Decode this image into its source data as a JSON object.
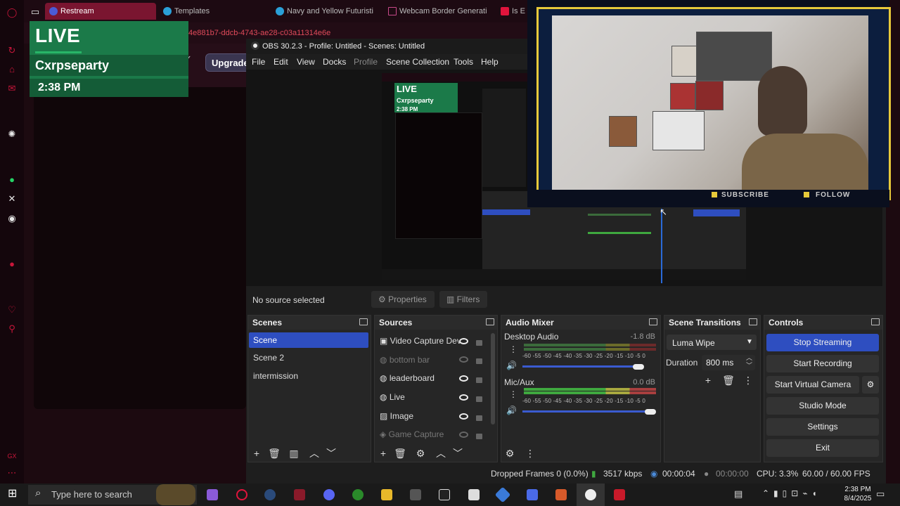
{
  "browser": {
    "tabs": [
      {
        "label": "Restream",
        "active": true
      },
      {
        "label": "Templates",
        "active": false
      },
      {
        "label": "Navy and Yellow Futuristi",
        "active": false
      },
      {
        "label": "Webcam Border Generati",
        "active": false
      },
      {
        "label": "Is E",
        "active": false
      }
    ],
    "url_fragment": "4e881b7-ddcb-4743-ae28-c03a11314e6e",
    "upgrade_label": "Upgrade"
  },
  "overlay": {
    "live_label": "LIVE",
    "channel_name": "Cxrpseparty",
    "time": "2:38 PM"
  },
  "obs": {
    "title": "OBS 30.2.3 - Profile: Untitled - Scenes: Untitled",
    "menu": [
      "File",
      "Edit",
      "View",
      "Docks",
      "Profile",
      "Scene Collection",
      "Tools",
      "Help"
    ],
    "no_source": "No source selected",
    "properties_label": "Properties",
    "filters_label": "Filters",
    "scenes": {
      "title": "Scenes",
      "items": [
        "Scene",
        "Scene 2",
        "intermission"
      ],
      "selected": 0
    },
    "sources": {
      "title": "Sources",
      "items": [
        {
          "label": "Video Capture Dev",
          "visible": true
        },
        {
          "label": "bottom bar",
          "visible": false
        },
        {
          "label": "leaderboard",
          "visible": true
        },
        {
          "label": "Live",
          "visible": true
        },
        {
          "label": "Image",
          "visible": true
        },
        {
          "label": "Game Capture",
          "visible": false
        }
      ]
    },
    "mixer": {
      "title": "Audio Mixer",
      "channels": [
        {
          "label": "Desktop Audio",
          "db": "-1.8 dB",
          "volume": 0.88
        },
        {
          "label": "Mic/Aux",
          "db": "0.0 dB",
          "volume": 1.0
        }
      ],
      "ticks": "-60 -55 -50 -45 -40 -35 -30 -25 -20 -15 -10 -5 0"
    },
    "transitions": {
      "title": "Scene Transitions",
      "selected": "Luma Wipe",
      "duration_label": "Duration",
      "duration_value": "800 ms"
    },
    "controls": {
      "title": "Controls",
      "stop_streaming": "Stop Streaming",
      "start_recording": "Start Recording",
      "start_virtual_camera": "Start Virtual Camera",
      "studio_mode": "Studio Mode",
      "settings": "Settings",
      "exit": "Exit"
    },
    "status": {
      "dropped": "Dropped Frames 0 (0.0%)",
      "bitrate": "3517 kbps",
      "stream_time": "00:00:04",
      "record_time": "00:00:00",
      "cpu": "CPU: 3.3%",
      "fps": "60.00 / 60.00 FPS"
    },
    "nested_preview": {
      "live": "LIVE",
      "name": "Cxrpseparty",
      "time": "2:38 PM"
    }
  },
  "webcam": {
    "subscribe": "SUBSCRIBE",
    "follow": "FOLLOW",
    "accent": "#e7c93a"
  },
  "taskbar": {
    "search_placeholder": "Type here to search",
    "time": "2:38 PM",
    "date": "8/4/2025"
  }
}
